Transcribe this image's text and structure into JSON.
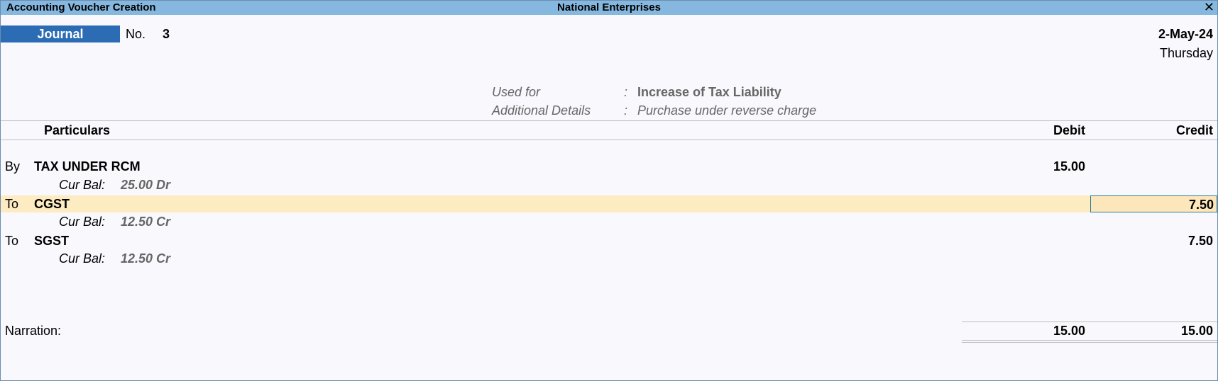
{
  "window": {
    "title": "Accounting Voucher Creation",
    "company": "National Enterprises",
    "close_glyph": "✕"
  },
  "voucher": {
    "type": "Journal",
    "no_label": "No.",
    "no_value": "3",
    "date": "2-May-24",
    "day": "Thursday"
  },
  "meta": {
    "used_for_label": "Used for",
    "used_for_value": "Increase of Tax Liability",
    "additional_label": "Additional Details",
    "additional_value": "Purchase under reverse charge",
    "colon": ":"
  },
  "columns": {
    "particulars": "Particulars",
    "debit": "Debit",
    "credit": "Credit"
  },
  "entries": [
    {
      "prefix": "By",
      "ledger": "TAX UNDER RCM",
      "debit": "15.00",
      "credit": "",
      "curbal_label": "Cur Bal:",
      "curbal_value": "25.00 Dr"
    },
    {
      "prefix": "To",
      "ledger": "CGST",
      "debit": "",
      "credit": "7.50",
      "curbal_label": "Cur Bal:",
      "curbal_value": "12.50 Cr"
    },
    {
      "prefix": "To",
      "ledger": "SGST",
      "debit": "",
      "credit": "7.50",
      "curbal_label": "Cur Bal:",
      "curbal_value": "12.50 Cr"
    }
  ],
  "footer": {
    "narration_label": "Narration:",
    "total_debit": "15.00",
    "total_credit": "15.00"
  },
  "colors": {
    "titlebar": "#86b8df",
    "voucher_type_bg": "#2b6cb5",
    "highlight_row": "#fdebc1",
    "background": "#f9f8fd"
  },
  "icons": {
    "close": "close-icon"
  }
}
